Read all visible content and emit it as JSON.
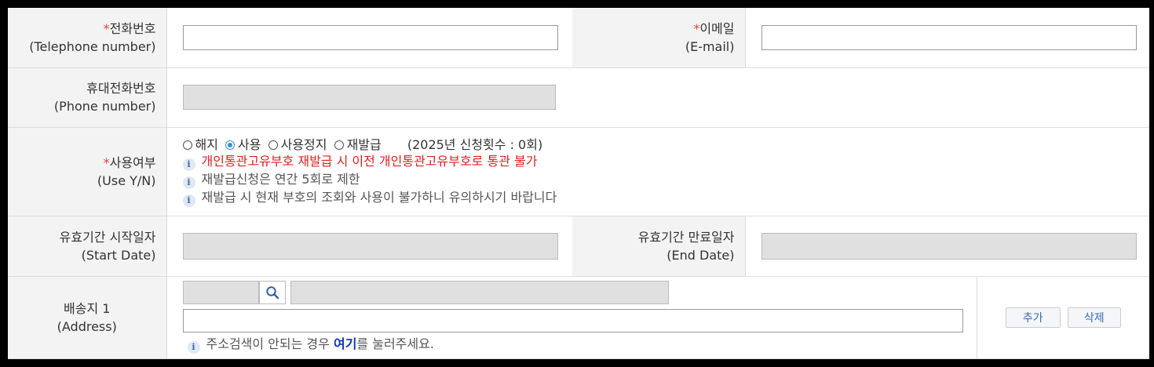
{
  "rows": {
    "telephone": {
      "label_ko": "전화번호",
      "label_en": "(Telephone number)",
      "required_mark": "*",
      "value": ""
    },
    "email": {
      "label_ko": "이메일",
      "label_en": "(E-mail)",
      "required_mark": "*",
      "value": ""
    },
    "phone": {
      "label_ko": "휴대전화번호",
      "label_en": "(Phone number)",
      "value": ""
    },
    "use": {
      "label_ko": "사용여부",
      "label_en": "(Use Y/N)",
      "required_mark": "*",
      "options": [
        "해지",
        "사용",
        "사용정지",
        "재발급"
      ],
      "selected": "사용",
      "count_text": "(2025년 신청횟수 : 0회)",
      "notes": [
        "개인통관고유부호 재발급 시 이전 개인통관고유부호로 통관 불가",
        "재발급신청은 연간 5회로 제한",
        "재발급 시 현재 부호의 조회와 사용이 불가하니 유의하시기 바랍니다"
      ]
    },
    "start_date": {
      "label_ko": "유효기간 시작일자",
      "label_en": "(Start Date)",
      "value": ""
    },
    "end_date": {
      "label_ko": "유효기간 만료일자",
      "label_en": "(End Date)",
      "value": ""
    },
    "address": {
      "label_ko": "배송지 1",
      "label_en": "(Address)",
      "zip": "",
      "address1": "",
      "address2": "",
      "help_prefix": "주소검색이 안되는 경우 ",
      "help_link": "여기",
      "help_suffix": "를 눌러주세요.",
      "add_button": "추가",
      "delete_button": "삭제"
    }
  },
  "colors": {
    "required": "#e0453a",
    "note_red": "#e02020",
    "accent": "#3a8fd6",
    "link": "#1436b4"
  },
  "icons": {
    "info": "info-icon",
    "search": "search-icon"
  }
}
